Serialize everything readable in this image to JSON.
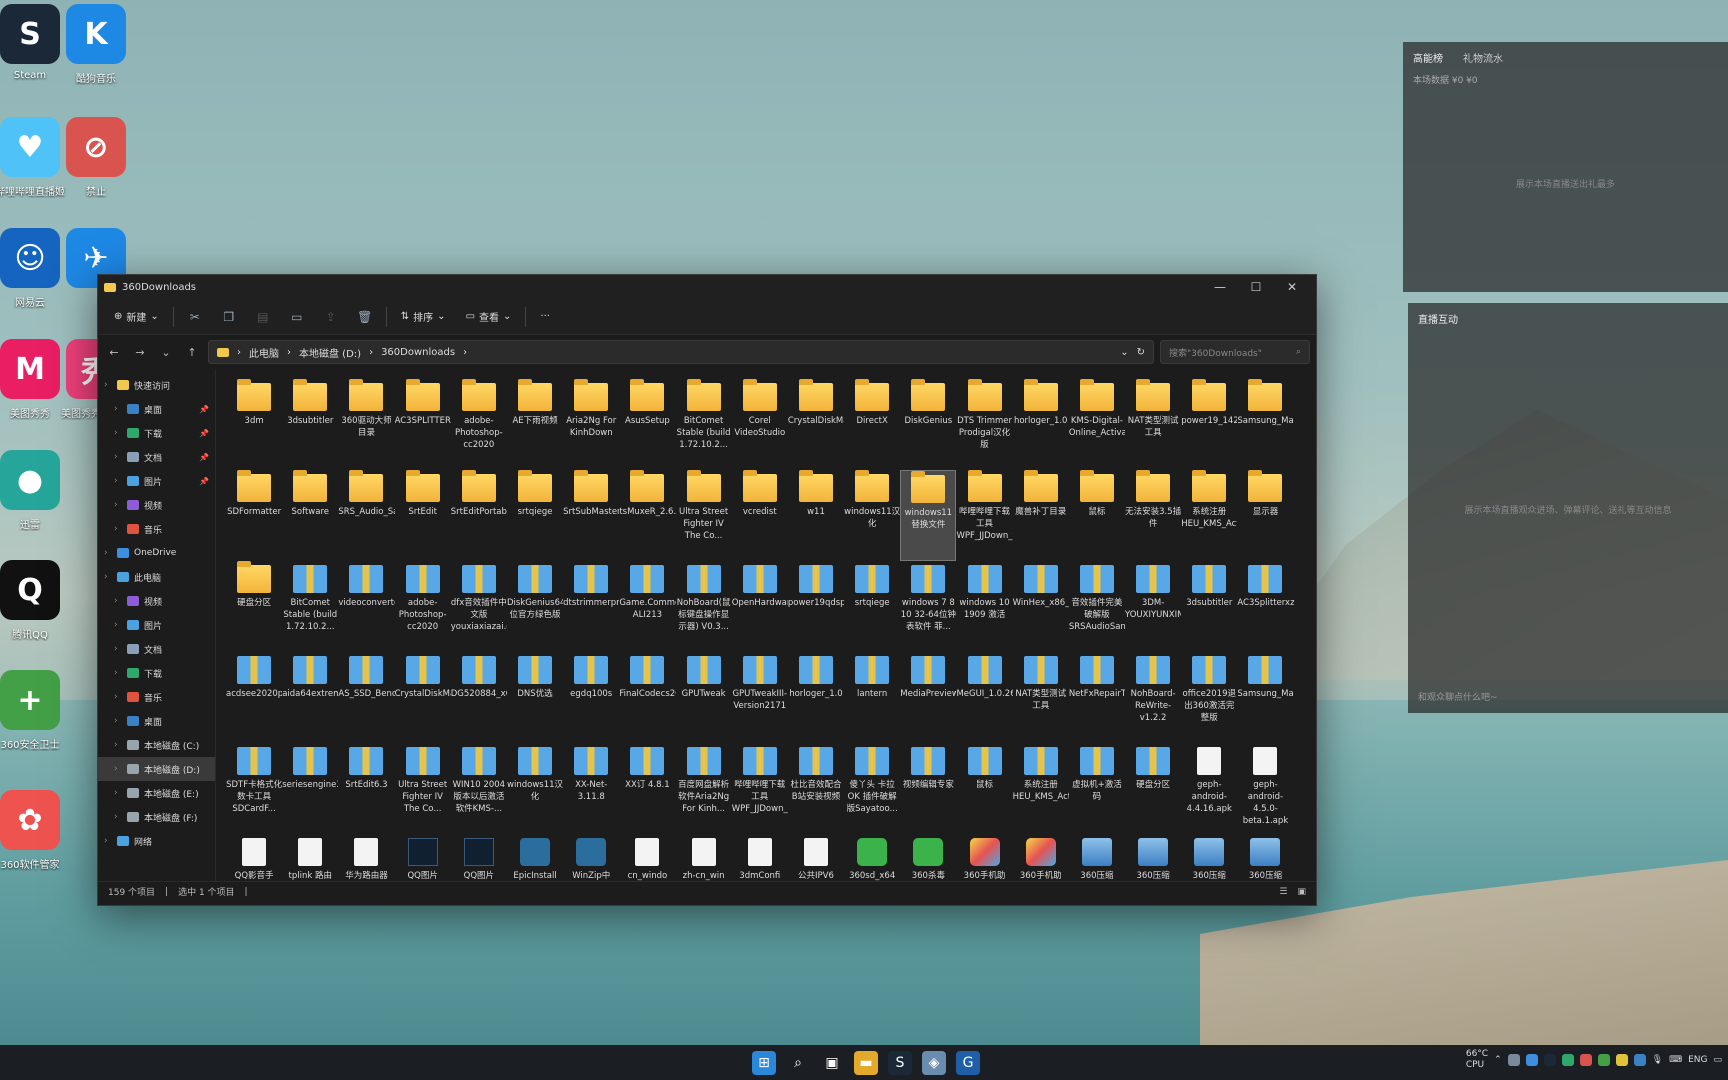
{
  "desktop": {
    "icons": [
      {
        "label": "Steam",
        "glyph": "S",
        "color": "#1b2838"
      },
      {
        "label": "酷狗音乐",
        "glyph": "K",
        "color": "#1e88e5"
      },
      {
        "label": "哔哩哔哩直播姬",
        "glyph": "♥",
        "color": "#4fc3f7"
      },
      {
        "label": "禁止",
        "glyph": "⊘",
        "color": "#d9534f"
      },
      {
        "label": "网易云",
        "glyph": "☺",
        "color": "#1565c0"
      },
      {
        "label": "",
        "glyph": "✈",
        "color": "#1e88e5"
      },
      {
        "label": "美图秀秀",
        "glyph": "M",
        "color": "#e91e63"
      },
      {
        "label": "美图秀秀批处理",
        "glyph": "秀",
        "color": "#ec407a"
      },
      {
        "label": "迅雷",
        "glyph": "●",
        "color": "#26a69a"
      },
      {
        "label": "腾讯QQ",
        "glyph": "Q",
        "color": "#111111"
      },
      {
        "label": "360安全卫士",
        "glyph": "+",
        "color": "#43a047"
      },
      {
        "label": "360软件管家",
        "glyph": "✿",
        "color": "#ef5350"
      }
    ]
  },
  "live_panel_top": {
    "tab1": "高能榜",
    "tab2": "礼物流水",
    "sub": "本场数据 ¥0  ¥0",
    "center": "展示本场直播送出礼最多"
  },
  "live_panel_mid": {
    "title": "直播互动",
    "center": "展示本场直播观众进场、弹幕评论、送礼等互动信息",
    "input_hint": "和观众聊点什么吧~"
  },
  "window": {
    "title": "360Downloads",
    "minimize": "—",
    "maximize": "☐",
    "close": "✕",
    "toolbar": {
      "new_label": "新建",
      "sort_label": "排序",
      "view_label": "查看",
      "more_label": "···"
    },
    "breadcrumb": [
      "此电脑",
      "本地磁盘 (D:)",
      "360Downloads"
    ],
    "search_placeholder": "搜索\"360Downloads\"",
    "sidebar": [
      {
        "label": "快速访问",
        "color": "#f2c94c",
        "level": 0,
        "pin": false
      },
      {
        "label": "桌面",
        "color": "#3b82c4",
        "level": 1,
        "pin": true
      },
      {
        "label": "下载",
        "color": "#2fa86b",
        "level": 1,
        "pin": true
      },
      {
        "label": "文档",
        "color": "#8aa0b8",
        "level": 1,
        "pin": true
      },
      {
        "label": "图片",
        "color": "#4aa3df",
        "level": 1,
        "pin": true
      },
      {
        "label": "视频",
        "color": "#8e5cd9",
        "level": 1,
        "pin": false
      },
      {
        "label": "音乐",
        "color": "#e0533f",
        "level": 1,
        "pin": false
      },
      {
        "label": "OneDrive",
        "color": "#3b8ee0",
        "level": 0,
        "pin": false
      },
      {
        "label": "此电脑",
        "color": "#4aa3df",
        "level": 0,
        "pin": false
      },
      {
        "label": "视频",
        "color": "#8e5cd9",
        "level": 1,
        "pin": false
      },
      {
        "label": "图片",
        "color": "#4aa3df",
        "level": 1,
        "pin": false
      },
      {
        "label": "文档",
        "color": "#8aa0b8",
        "level": 1,
        "pin": false
      },
      {
        "label": "下载",
        "color": "#2fa86b",
        "level": 1,
        "pin": false
      },
      {
        "label": "音乐",
        "color": "#e0533f",
        "level": 1,
        "pin": false
      },
      {
        "label": "桌面",
        "color": "#3b82c4",
        "level": 1,
        "pin": false
      },
      {
        "label": "本地磁盘 (C:)",
        "color": "#9aa4ad",
        "level": 1,
        "pin": false
      },
      {
        "label": "本地磁盘 (D:)",
        "color": "#9aa4ad",
        "level": 1,
        "pin": false,
        "selected": true
      },
      {
        "label": "本地磁盘 (E:)",
        "color": "#9aa4ad",
        "level": 1,
        "pin": false
      },
      {
        "label": "本地磁盘 (F:)",
        "color": "#9aa4ad",
        "level": 1,
        "pin": false
      },
      {
        "label": "网络",
        "color": "#4aa3df",
        "level": 0,
        "pin": false
      }
    ],
    "files": [
      {
        "n": "3dm",
        "t": "folder"
      },
      {
        "n": "3dsubtitler",
        "t": "folder"
      },
      {
        "n": "360驱动大师目录",
        "t": "folder"
      },
      {
        "n": "AC3SPLITTER",
        "t": "folder"
      },
      {
        "n": "adobe-Photoshop-cc2020",
        "t": "folder"
      },
      {
        "n": "AE下雨视频",
        "t": "folder"
      },
      {
        "n": "Aria2Ng For KinhDown",
        "t": "folder"
      },
      {
        "n": "AsusSetup",
        "t": "folder"
      },
      {
        "n": "BitComet Stable (build 1.72.10.2...",
        "t": "folder"
      },
      {
        "n": "Corel VideoStudio",
        "t": "folder"
      },
      {
        "n": "CrystalDiskMark_7.0.0.2019",
        "t": "folder"
      },
      {
        "n": "DirectX",
        "t": "folder"
      },
      {
        "n": "DiskGenius",
        "t": "folder"
      },
      {
        "n": "DTS Trimmer Prodigal汉化版",
        "t": "folder"
      },
      {
        "n": "horloger_1.0",
        "t": "folder"
      },
      {
        "n": "KMS-Digital-Online_Activation_Suite_v6.8",
        "t": "folder"
      },
      {
        "n": "NAT类型测试工具",
        "t": "folder"
      },
      {
        "n": "power19_142916",
        "t": "folder"
      },
      {
        "n": "Samsung_Magician_Installer",
        "t": "folder"
      },
      {
        "n": "SDFormatter",
        "t": "folder"
      },
      {
        "n": "Software",
        "t": "folder"
      },
      {
        "n": "SRS_Audio_Sandbox",
        "t": "folder"
      },
      {
        "n": "SrtEdit",
        "t": "folder"
      },
      {
        "n": "SrtEditPortable",
        "t": "folder"
      },
      {
        "n": "srtqiege",
        "t": "folder"
      },
      {
        "n": "SrtSubMaster(jb51.net)",
        "t": "folder"
      },
      {
        "n": "tsMuxeR_2.6.12",
        "t": "folder"
      },
      {
        "n": "Ultra Street Fighter IV The Co...",
        "t": "folder"
      },
      {
        "n": "vcredist",
        "t": "folder"
      },
      {
        "n": "w11",
        "t": "folder"
      },
      {
        "n": "windows11汉化",
        "t": "folder"
      },
      {
        "n": "windows11替换文件",
        "t": "folder",
        "sel": true
      },
      {
        "n": "哔哩哔哩下载工具WPF_JJDown_v1.22...",
        "t": "folder"
      },
      {
        "n": "魔兽补丁目录",
        "t": "folder"
      },
      {
        "n": "鼠标",
        "t": "folder"
      },
      {
        "n": "无法安装3.5插件",
        "t": "folder"
      },
      {
        "n": "系统注册HEU_KMS_Activator_v20.0.0",
        "t": "folder"
      },
      {
        "n": "显示器",
        "t": "folder"
      },
      {
        "n": "硬盘分区",
        "t": "folder"
      },
      {
        "n": "BitComet Stable (build 1.72.10.2...",
        "t": "zip"
      },
      {
        "n": "videoconverter_install_chs",
        "t": "zip"
      },
      {
        "n": "adobe-Photoshop-cc2020",
        "t": "zip"
      },
      {
        "n": "dfx音效插件中文版youxiaxiazai.com",
        "t": "zip"
      },
      {
        "n": "DiskGenius64位官方绿色版",
        "t": "zip"
      },
      {
        "n": "dtstrimmerprodigal",
        "t": "zip"
      },
      {
        "n": "Game.CommonRedist.V4-ALI213",
        "t": "zip"
      },
      {
        "n": "NohBoard(鼠标键盘操作显示器) V0.3...",
        "t": "zip"
      },
      {
        "n": "OpenHardwareMonitor",
        "t": "zip"
      },
      {
        "n": "power19qdspo",
        "t": "zip"
      },
      {
        "n": "srtqiege",
        "t": "zip"
      },
      {
        "n": "windows 7 8 10 32-64位钟表软件 菲...",
        "t": "zip"
      },
      {
        "n": "windows 10 1909 激活",
        "t": "zip"
      },
      {
        "n": "WinHex_x86_x64_Chs_pojieban",
        "t": "zip"
      },
      {
        "n": "音效插件完美破解版SRSAudioSandbox",
        "t": "zip"
      },
      {
        "n": "3DM-YOUXIYUNXINGKU.v3.0",
        "t": "zip"
      },
      {
        "n": "3dsubtitler",
        "t": "zip"
      },
      {
        "n": "AC3Splitterxz(1)",
        "t": "zip"
      },
      {
        "n": "acdsee2020pjb",
        "t": "zip"
      },
      {
        "n": "aida64extreme_build_5462_kh9ybtp6zq",
        "t": "zip"
      },
      {
        "n": "AS_SSD_Benchmark",
        "t": "zip"
      },
      {
        "n": "CrystalDiskMark_7.0.0.2019",
        "t": "zip"
      },
      {
        "n": "DG520884_x64",
        "t": "zip"
      },
      {
        "n": "DNS优选",
        "t": "zip"
      },
      {
        "n": "egdq100s",
        "t": "zip"
      },
      {
        "n": "FinalCodecs2020spV3",
        "t": "zip"
      },
      {
        "n": "GPUTweak",
        "t": "zip"
      },
      {
        "n": "GPUTweakIII-Version2171",
        "t": "zip"
      },
      {
        "n": "horloger_1.0",
        "t": "zip"
      },
      {
        "n": "lantern",
        "t": "zip"
      },
      {
        "n": "MediaPreview",
        "t": "zip"
      },
      {
        "n": "MeGUI_1.0.2624",
        "t": "zip"
      },
      {
        "n": "NAT类型测试工具",
        "t": "zip"
      },
      {
        "n": "NetFxRepairTool_1.3",
        "t": "zip"
      },
      {
        "n": "NohBoard-ReWrite-v1.2.2",
        "t": "zip"
      },
      {
        "n": "office2019退出360激活完整版",
        "t": "zip"
      },
      {
        "n": "Samsung_Magician_Installer_Official_7.0...",
        "t": "zip"
      },
      {
        "n": "SDTF卡格式化数卡工具SDCardF...",
        "t": "zip"
      },
      {
        "n": "seriesengine3134",
        "t": "zip"
      },
      {
        "n": "SrtEdit6.3",
        "t": "zip"
      },
      {
        "n": "Ultra Street Fighter IV The Co...",
        "t": "zip"
      },
      {
        "n": "WIN10 2004版本以后激活软件KMS-...",
        "t": "zip"
      },
      {
        "n": "windows11汉化",
        "t": "zip"
      },
      {
        "n": "XX-Net-3.11.8",
        "t": "zip"
      },
      {
        "n": "XX订 4.8.1",
        "t": "zip"
      },
      {
        "n": "百度网盘解析软件Aria2Ng For Kinh...",
        "t": "zip"
      },
      {
        "n": "哔哩哔哩下载工具WPF_JJDown_v1.22...",
        "t": "zip"
      },
      {
        "n": "杜比音效配合B站安装视频",
        "t": "zip"
      },
      {
        "n": "傻丫头 卡拉OK 插件破解版Sayatoo...",
        "t": "zip"
      },
      {
        "n": "视频编辑专家",
        "t": "zip"
      },
      {
        "n": "鼠标",
        "t": "zip"
      },
      {
        "n": "系统注册HEU_KMS_Activator_v20.0.0",
        "t": "zip"
      },
      {
        "n": "虚拟机+激活码",
        "t": "zip"
      },
      {
        "n": "硬盘分区",
        "t": "zip"
      },
      {
        "n": "geph-android-4.4.16.apk",
        "t": "file"
      },
      {
        "n": "geph-android-4.5.0-beta.1.apk",
        "t": "file"
      },
      {
        "n": "QQ影音手",
        "t": "file"
      },
      {
        "n": "tplink 路由",
        "t": "file"
      },
      {
        "n": "华为路由器",
        "t": "file"
      },
      {
        "n": "QQ图片",
        "t": "dark"
      },
      {
        "n": "QQ图片",
        "t": "dark"
      },
      {
        "n": "EpicInstall",
        "t": "exe"
      },
      {
        "n": "WinZip中",
        "t": "exe"
      },
      {
        "n": "cn_windo",
        "t": "file"
      },
      {
        "n": "zh-cn_win",
        "t": "file"
      },
      {
        "n": "3dmConfi",
        "t": "file"
      },
      {
        "n": "公共IPV6",
        "t": "file"
      },
      {
        "n": "360sd_x64",
        "t": "green"
      },
      {
        "n": "360杀毒",
        "t": "green"
      },
      {
        "n": "360手机助",
        "t": "app"
      },
      {
        "n": "360手机助",
        "t": "app"
      },
      {
        "n": "360压缩",
        "t": "pkg"
      },
      {
        "n": "360压缩",
        "t": "pkg"
      },
      {
        "n": "360压缩",
        "t": "pkg"
      },
      {
        "n": "360压缩",
        "t": "pkg"
      }
    ],
    "status_count": "159 个项目",
    "status_selected": "选中 1 个项目"
  },
  "taskbar": {
    "weather_temp": "66°C",
    "weather_label": "CPU",
    "lang": "ENG",
    "apps": [
      {
        "name": "start-icon",
        "glyph": "⊞",
        "color": "#2b88d8"
      },
      {
        "name": "search-icon",
        "glyph": "⌕",
        "color": "transparent"
      },
      {
        "name": "task-view-icon",
        "glyph": "▣",
        "color": "transparent"
      },
      {
        "name": "file-explorer-icon",
        "glyph": "▬",
        "color": "#e3a92b"
      },
      {
        "name": "steam-icon",
        "glyph": "S",
        "color": "#1b2838"
      },
      {
        "name": "app-icon",
        "glyph": "◈",
        "color": "#6a8caf"
      },
      {
        "name": "g-app-icon",
        "glyph": "G",
        "color": "#1f5fa8"
      }
    ]
  }
}
